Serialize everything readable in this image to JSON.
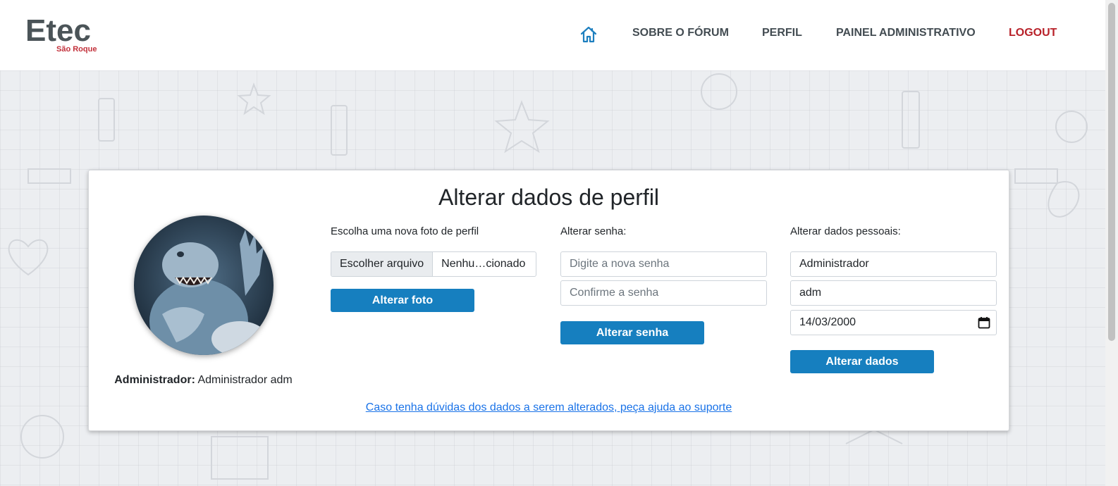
{
  "header": {
    "logo": {
      "main": "Etec",
      "sub": "São Roque"
    },
    "nav": {
      "home_icon": "home-icon",
      "items": [
        {
          "label": "SOBRE O FÓRUM"
        },
        {
          "label": "PERFIL"
        },
        {
          "label": "PAINEL ADMINISTRATIVO"
        },
        {
          "label": "LOGOUT"
        }
      ]
    }
  },
  "card": {
    "title": "Alterar dados de perfil",
    "avatar_caption": {
      "role": "Administrador:",
      "name": "Administrador adm"
    },
    "photo": {
      "label": "Escolha uma nova foto de perfil",
      "file_button": "Escolher arquivo",
      "file_name": "Nenhu…cionado",
      "submit": "Alterar foto"
    },
    "password": {
      "label": "Alterar senha:",
      "new_placeholder": "Digite a nova senha",
      "confirm_placeholder": "Confirme a senha",
      "submit": "Alterar senha"
    },
    "personal": {
      "label": "Alterar dados pessoais:",
      "name_value": "Administrador",
      "surname_value": "adm",
      "birthdate_value": "14/03/2000",
      "submit": "Alterar dados"
    },
    "support_link": "Caso tenha dúvidas dos dados a serem alterados, peça ajuda ao suporte"
  },
  "colors": {
    "accent": "#167fbf",
    "logout": "#b82129",
    "logo_sub": "#c2303a",
    "link": "#1a73e8"
  }
}
